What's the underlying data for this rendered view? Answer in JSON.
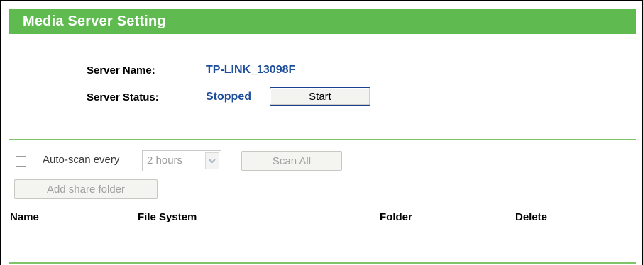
{
  "header": {
    "title": "Media Server Setting"
  },
  "server": {
    "name_label": "Server Name:",
    "name_value": "TP-LINK_13098F",
    "status_label": "Server Status:",
    "status_value": "Stopped",
    "start_button": "Start"
  },
  "scan": {
    "auto_scan_checked": false,
    "auto_scan_label": "Auto-scan every",
    "interval_selected": "2 hours",
    "scan_all_button": "Scan All",
    "add_share_folder_button": "Add share folder"
  },
  "table": {
    "columns": [
      "Name",
      "File System",
      "Folder",
      "Delete"
    ],
    "rows": []
  },
  "colors": {
    "header_green": "#5fba50",
    "divider_green": "#7dc46b",
    "value_blue": "#1d4e9b"
  }
}
